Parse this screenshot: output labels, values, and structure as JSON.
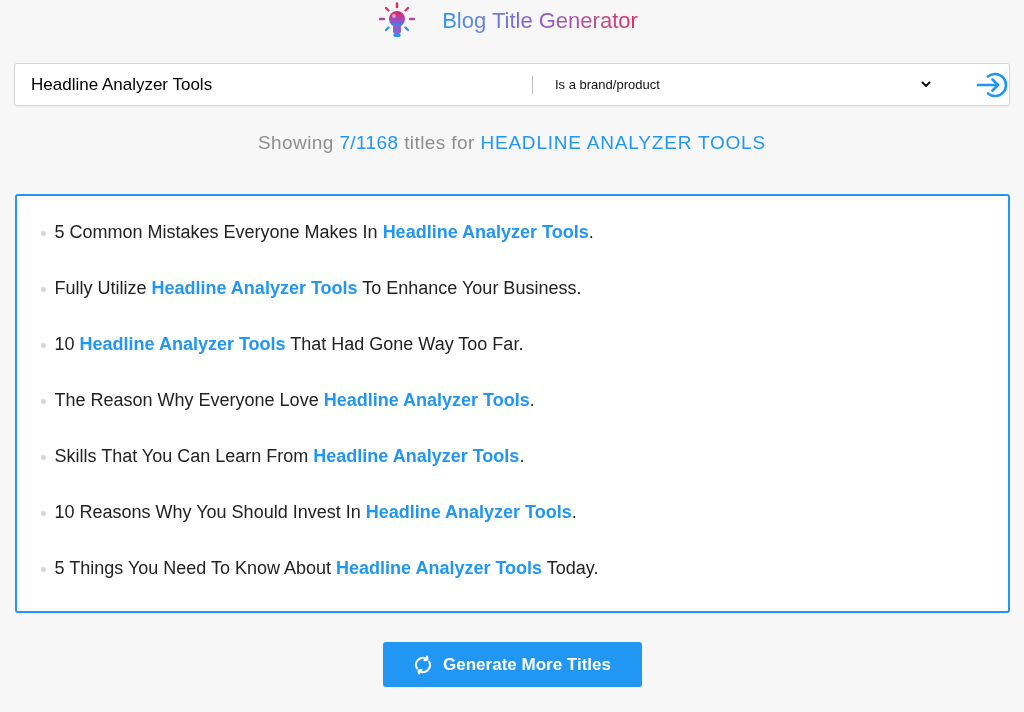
{
  "header": {
    "title": "Blog Title Generator"
  },
  "search": {
    "value": "Headline Analyzer Tools",
    "type": "Is a brand/product"
  },
  "summary": {
    "prefix": "Showing ",
    "count": "7/1168",
    "middle": " titles for ",
    "keyword": "HEADLINE ANALYZER TOOLS"
  },
  "titles": [
    {
      "before": "5 Common Mistakes Everyone Makes In ",
      "keyword": "Headline Analyzer Tools",
      "after": "."
    },
    {
      "before": "Fully Utilize ",
      "keyword": "Headline Analyzer Tools",
      "after": " To Enhance Your Business."
    },
    {
      "before": "10 ",
      "keyword": "Headline Analyzer Tools",
      "after": " That Had Gone Way Too Far."
    },
    {
      "before": "The Reason Why Everyone Love ",
      "keyword": "Headline Analyzer Tools",
      "after": "."
    },
    {
      "before": "Skills That You Can Learn From ",
      "keyword": "Headline Analyzer Tools",
      "after": "."
    },
    {
      "before": "10 Reasons Why You Should Invest In ",
      "keyword": "Headline Analyzer Tools",
      "after": "."
    },
    {
      "before": "5 Things You Need To Know About ",
      "keyword": "Headline Analyzer Tools",
      "after": " Today."
    }
  ],
  "button": {
    "label": "Generate More Titles"
  }
}
